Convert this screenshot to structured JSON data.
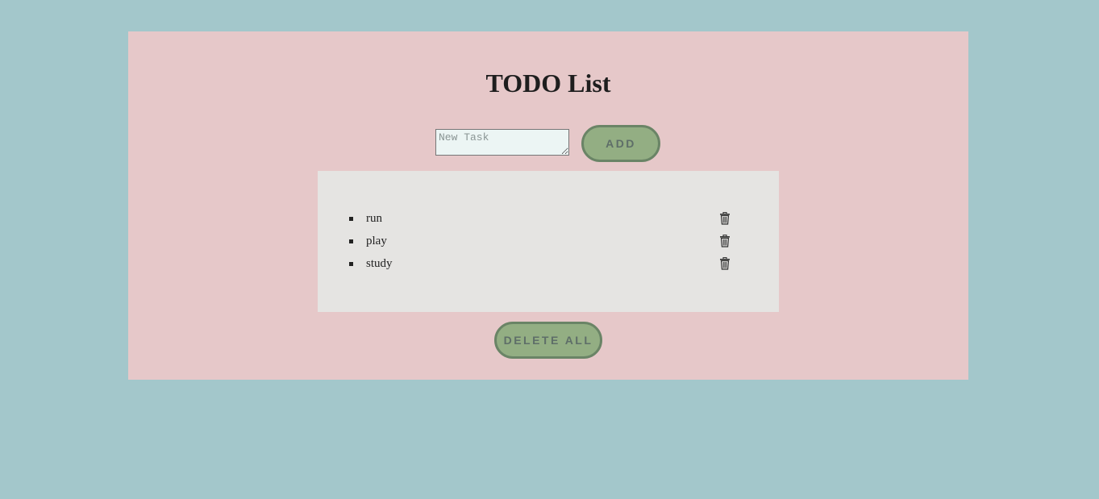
{
  "header": {
    "title": "TODO List"
  },
  "form": {
    "input_placeholder": "New Task",
    "input_value": "",
    "add_label": "ADD"
  },
  "tasks": [
    {
      "text": "run",
      "delete_icon": "trash-icon"
    },
    {
      "text": "play",
      "delete_icon": "trash-icon"
    },
    {
      "text": "study",
      "delete_icon": "trash-icon"
    }
  ],
  "footer": {
    "delete_all_label": "DELETE ALL"
  },
  "colors": {
    "page_background": "#a3c7cb",
    "panel_background": "#e6c8c9",
    "list_background": "#e5e4e2",
    "button_fill": "#93ae83",
    "button_border": "#6a8466",
    "button_text": "#5e6e68",
    "input_background": "#ecf5f4"
  }
}
